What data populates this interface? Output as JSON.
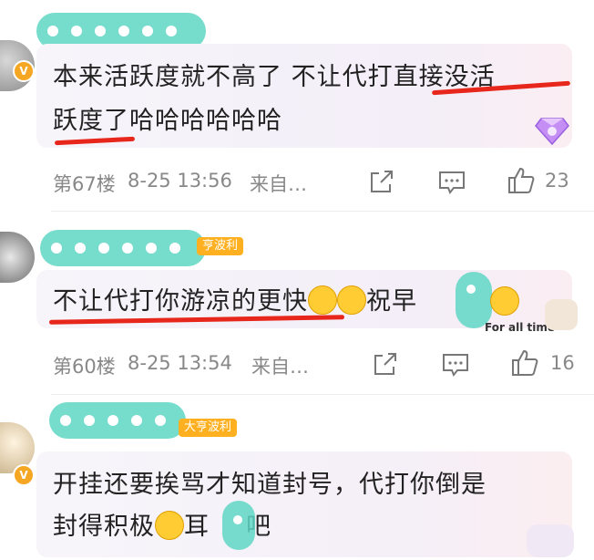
{
  "posts": [
    {
      "tag": "",
      "comment_text_line1": "本来活跃度就不高了 不让代打直接没活",
      "comment_text_line2": "跃度了哈哈哈哈哈哈",
      "floor": "第67楼",
      "datetime": "8-25 13:56",
      "source": "来自…",
      "like_count": "23"
    },
    {
      "tag": "亨波利",
      "comment_text_a": "不让代打你游凉的更快",
      "comment_text_b": "祝早",
      "deco_label": "For all time",
      "floor": "第60楼",
      "datetime": "8-25 13:54",
      "source": "来自…",
      "like_count": "16"
    },
    {
      "tag": "大亨波利",
      "comment_text_line1": "开挂还要挨骂才知道封号，代打你倒是",
      "comment_text_line2a": "封得积极",
      "comment_text_line2b": "耳",
      "comment_text_line2c": "吧"
    }
  ],
  "icons": {
    "share": "share-icon",
    "comment": "comment-icon",
    "like": "thumbs-up-icon",
    "verified": "verified-badge-icon"
  },
  "colors": {
    "highlight_red": "#e8271c",
    "censor_teal": "#5fd6c4",
    "tag_orange": "#ffb020"
  }
}
